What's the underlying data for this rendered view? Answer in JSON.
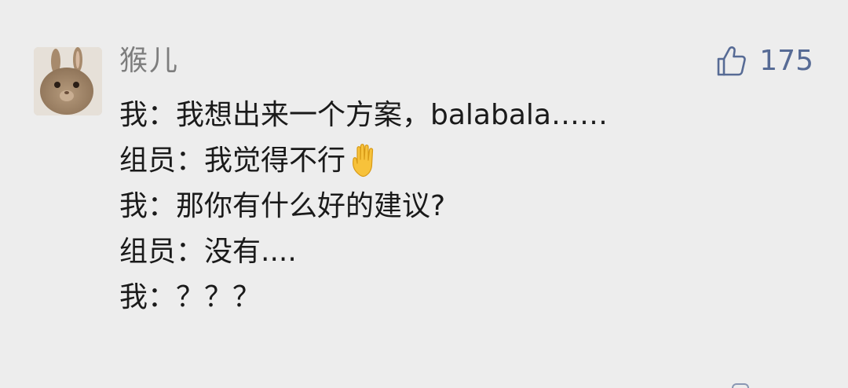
{
  "comment": {
    "username": "猴儿",
    "like_icon": "thumbs-up-icon",
    "like_count": "175",
    "accent_color": "#576b95",
    "lines": [
      {
        "text": "我：我想出来一个方案，balabala……"
      },
      {
        "text": "组员：我觉得不行",
        "emoji": "raised-hand-icon"
      },
      {
        "text": "我：那你有什么好的建议?"
      },
      {
        "text": "组员：没有...."
      },
      {
        "text": "我：？？？"
      }
    ]
  }
}
